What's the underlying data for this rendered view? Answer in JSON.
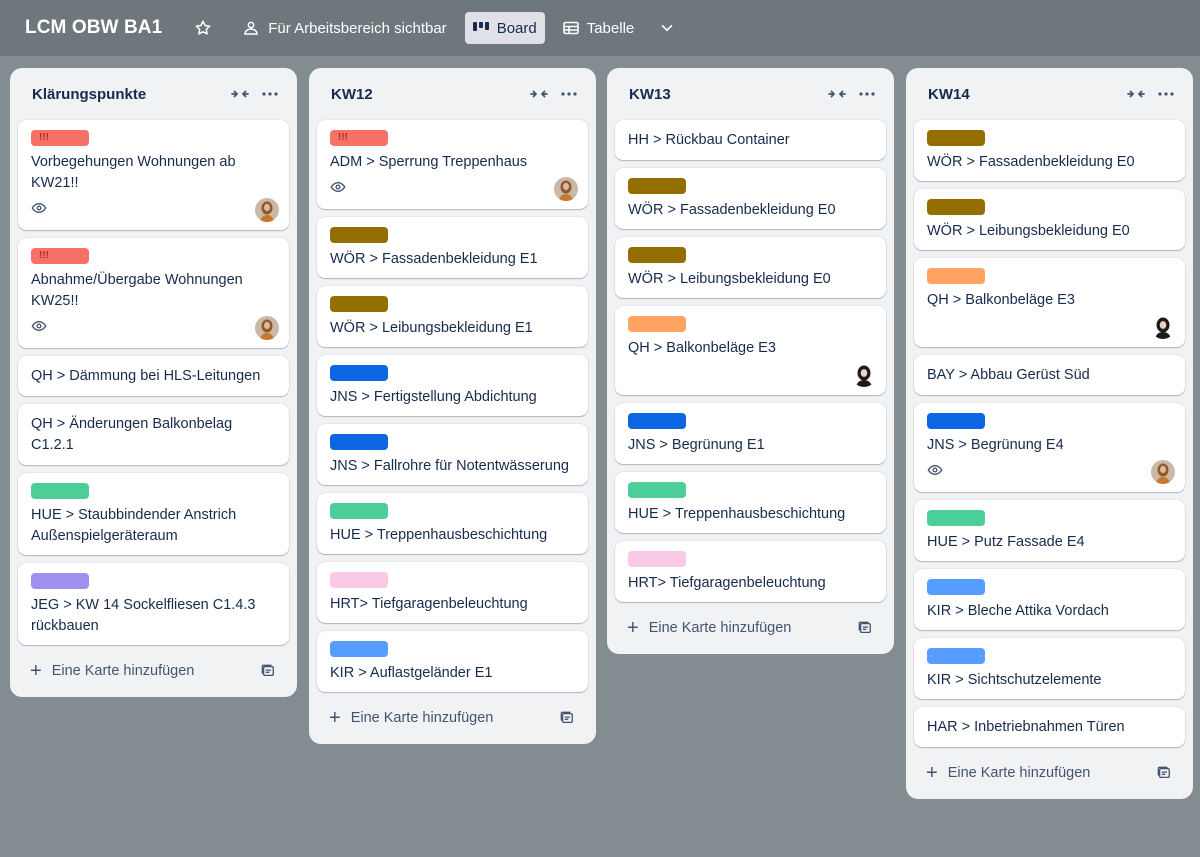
{
  "header": {
    "board_title": "LCM OBW BA1",
    "visibility_label": "Für Arbeitsbereich sichtbar",
    "view_board_label": "Board",
    "view_table_label": "Tabelle"
  },
  "add_card_label": "Eine Karte hinzufügen",
  "label_colors": {
    "red": "#f87168",
    "brown": "#946f00",
    "blue": "#0c66e4",
    "green": "#4bce97",
    "pink": "#f9c9e6",
    "purple": "#9f8fef",
    "orange": "#fea362",
    "light_blue": "#579dff"
  },
  "lists": [
    {
      "title": "Klärungspunkte",
      "cards": [
        {
          "label": "red",
          "label_text": "!!!",
          "text": "Vorbegehungen Wohnungen ab KW21!!",
          "watch": true,
          "avatar": "woman-avatar"
        },
        {
          "label": "red",
          "label_text": "!!!",
          "text": "Abnahme/Übergabe Wohnungen KW25!!",
          "watch": true,
          "avatar": "woman-avatar"
        },
        {
          "text": "QH > Dämmung bei HLS-Leitungen"
        },
        {
          "text": "QH > Änderungen Balkonbelag C1.2.1"
        },
        {
          "label": "green",
          "text": "HUE > Staubbindender Anstrich Außenspielgeräteraum"
        },
        {
          "label": "purple",
          "text": "JEG > KW 14 Sockelfliesen C1.4.3 rückbauen"
        }
      ]
    },
    {
      "title": "KW12",
      "cards": [
        {
          "label": "red",
          "label_text": "!!!",
          "text": "ADM > Sperrung Treppenhaus",
          "watch": true,
          "avatar": "woman-avatar"
        },
        {
          "label": "brown",
          "text": "WÖR > Fassadenbekleidung E1"
        },
        {
          "label": "brown",
          "text": "WÖR > Leibungsbekleidung E1"
        },
        {
          "label": "blue",
          "text": "JNS > Fertigstellung Abdichtung"
        },
        {
          "label": "blue",
          "text": "JNS > Fallrohre für Notentwässerung"
        },
        {
          "label": "green",
          "text": "HUE > Treppenhausbeschichtung"
        },
        {
          "label": "pink",
          "text": "HRT> Tiefgaragenbeleuchtung"
        },
        {
          "label": "light_blue",
          "text": "KIR > Auflastgeländer E1"
        }
      ]
    },
    {
      "title": "KW13",
      "cards": [
        {
          "text": "HH > Rückbau Container"
        },
        {
          "label": "brown",
          "text": "WÖR > Fassadenbekleidung E0"
        },
        {
          "label": "brown",
          "text": "WÖR > Leibungsbekleidung E0"
        },
        {
          "label": "orange",
          "text": "QH > Balkonbeläge E3",
          "avatar": "dark-avatar"
        },
        {
          "label": "blue",
          "text": "JNS > Begrünung E1"
        },
        {
          "label": "green",
          "text": "HUE > Treppenhausbeschichtung"
        },
        {
          "label": "pink",
          "text": "HRT> Tiefgaragenbeleuchtung"
        }
      ]
    },
    {
      "title": "KW14",
      "cards": [
        {
          "label": "brown",
          "text": "WÖR > Fassadenbekleidung E0"
        },
        {
          "label": "brown",
          "text": "WÖR > Leibungsbekleidung E0"
        },
        {
          "label": "orange",
          "text": "QH > Balkonbeläge E3",
          "avatar": "dark-avatar"
        },
        {
          "text": "BAY > Abbau Gerüst Süd"
        },
        {
          "label": "blue",
          "text": "JNS > Begrünung E4",
          "watch": true,
          "avatar": "woman-avatar"
        },
        {
          "label": "green",
          "text": "HUE > Putz Fassade E4"
        },
        {
          "label": "light_blue",
          "text": "KIR > Bleche Attika Vordach"
        },
        {
          "label": "light_blue",
          "text": "KIR > Sichtschutzelemente"
        },
        {
          "text": "HAR > Inbetriebnahmen Türen"
        }
      ]
    }
  ]
}
